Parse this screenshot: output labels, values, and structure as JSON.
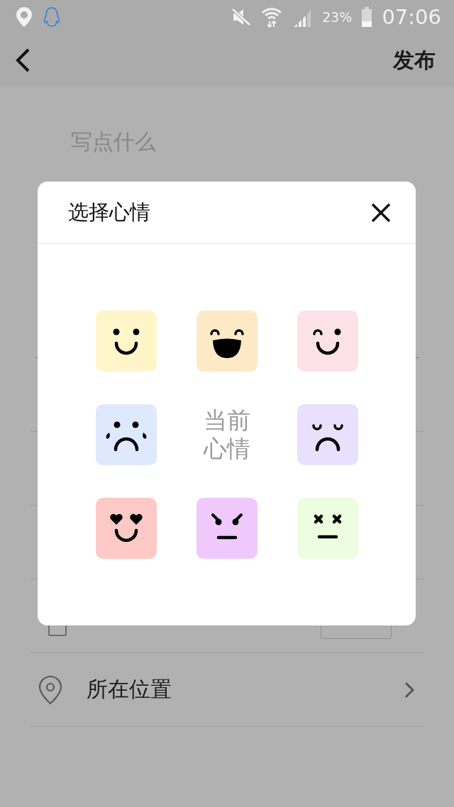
{
  "status_bar": {
    "battery_text": "23%",
    "time": "07:06"
  },
  "app_bar": {
    "action": "发布"
  },
  "composer": {
    "placeholder": "写点什么"
  },
  "location_row": {
    "label": "所在位置"
  },
  "mood_dialog": {
    "title": "选择心情",
    "cells": [
      {
        "kind": "smile",
        "color": "#fff5c9"
      },
      {
        "kind": "grin",
        "color": "#fde9c6"
      },
      {
        "kind": "wink",
        "color": "#fde1e8"
      },
      {
        "kind": "cry",
        "color": "#dfe9fd"
      },
      {
        "kind": "label",
        "text": "当前心情"
      },
      {
        "kind": "sad",
        "color": "#e8e0fc"
      },
      {
        "kind": "love",
        "color": "#fdc9c6"
      },
      {
        "kind": "angry",
        "color": "#efc9fb"
      },
      {
        "kind": "dizzy",
        "color": "#edfde0"
      }
    ]
  }
}
